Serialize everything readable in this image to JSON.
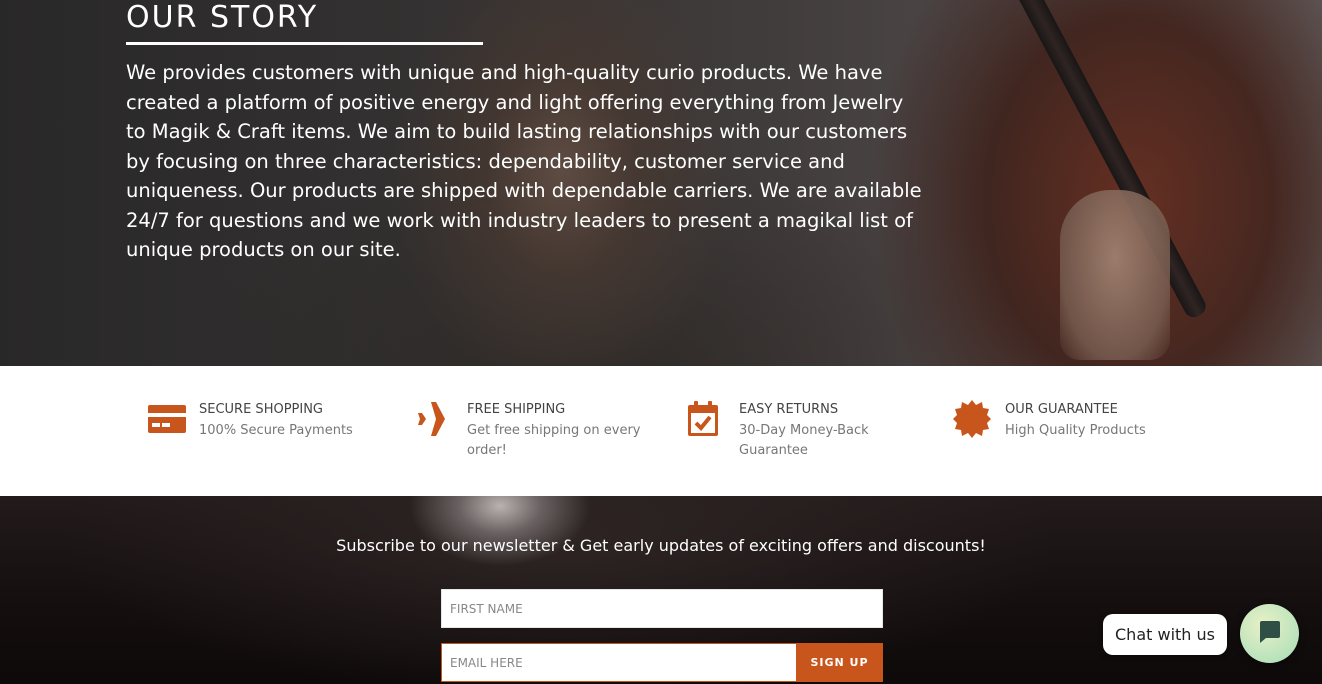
{
  "story": {
    "title": "OUR STORY",
    "text": "We provides customers with unique and high-quality curio products. We have created a platform of positive energy and light offering everything from Jewelry to Magik & Craft items.  We aim to build lasting relationships with our customers by focusing on three characteristics: dependability, customer service and uniqueness. Our products are shipped with dependable carriers. We are available 24/7 for questions and we work with industry leaders to present a magikal list of unique products on our site."
  },
  "features": [
    {
      "icon": "credit-card-icon",
      "title": "SECURE SHOPPING",
      "desc": "100% Secure Payments"
    },
    {
      "icon": "airplane-icon",
      "title": "FREE SHIPPING",
      "desc": "Get free shipping on every order!"
    },
    {
      "icon": "calendar-check-icon",
      "title": "EASY RETURNS",
      "desc": "30-Day Money-Back Guarantee"
    },
    {
      "icon": "badge-icon",
      "title": "OUR GUARANTEE",
      "desc": "High Quality Products"
    }
  ],
  "newsletter": {
    "heading": "Subscribe to our newsletter & Get early updates of exciting offers and discounts!",
    "first_name_placeholder": "FIRST NAME",
    "email_placeholder": "EMAIL HERE",
    "signup_label": "SIGN UP"
  },
  "chat": {
    "label": "Chat with us",
    "icon": "chat-icon"
  },
  "colors": {
    "accent": "#c8561c",
    "chat_button": "#b9e3bc"
  }
}
